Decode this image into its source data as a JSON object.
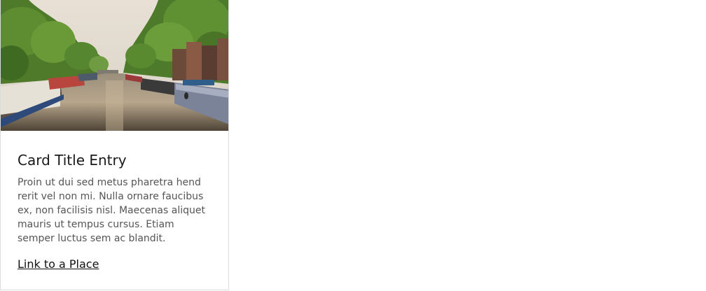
{
  "card": {
    "image": {
      "subject": "canal-with-houseboats-and-trees"
    },
    "title": "Card Title Entry",
    "text": "Proin ut dui sed metus pharetra hend rerit vel non mi. Nulla ornare faucibus ex, non facilisis nisl. Maecenas aliquet mauris ut tempus cursus. Etiam semper luctus sem ac blandit.",
    "link_label": "Link to a Place"
  }
}
